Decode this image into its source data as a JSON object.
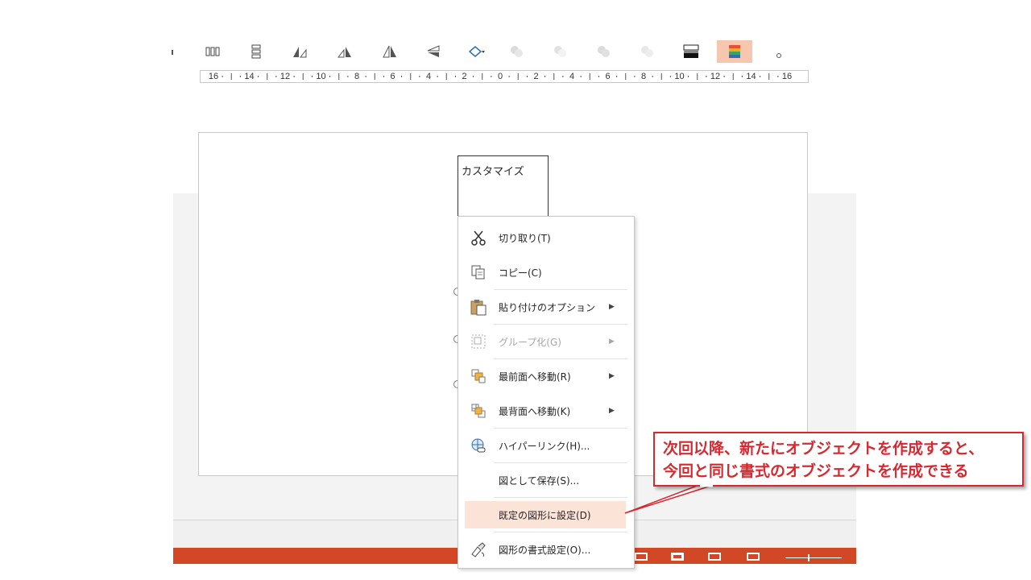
{
  "toolbar": {
    "buttons": [
      {
        "name": "distribute-horizontally-icon"
      },
      {
        "name": "distribute-vertically-icon"
      },
      {
        "name": "rotate-left-icon"
      },
      {
        "name": "rotate-right-icon"
      },
      {
        "name": "flip-horizontal-icon"
      },
      {
        "name": "flip-vertical-icon"
      },
      {
        "name": "edit-shape-icon"
      },
      {
        "name": "shape-effect-1-icon"
      },
      {
        "name": "shape-effect-2-icon"
      },
      {
        "name": "shape-effect-3-icon"
      },
      {
        "name": "shape-effect-4-icon"
      },
      {
        "name": "gradient-fill-icon"
      },
      {
        "name": "color-fill-icon",
        "active": true
      }
    ]
  },
  "ruler": {
    "labels": [
      "16",
      "14",
      "12",
      "10",
      "8",
      "6",
      "4",
      "2",
      "0",
      "2",
      "4",
      "6",
      "8",
      "10",
      "12",
      "14",
      "16"
    ]
  },
  "slide": {
    "shape_text": "カスタマイズ"
  },
  "context_menu": {
    "items": [
      {
        "label": "切り取り(T)",
        "icon": "scissors-icon",
        "submenu": false,
        "enabled": true
      },
      {
        "label": "コピー(C)",
        "icon": "copy-icon",
        "submenu": false,
        "enabled": true
      },
      {
        "label": "貼り付けのオプション",
        "icon": "paste-icon",
        "submenu": true,
        "enabled": true
      },
      {
        "label": "グループ化(G)",
        "icon": "group-icon",
        "submenu": true,
        "enabled": false
      },
      {
        "label": "最前面へ移動(R)",
        "icon": "bring-to-front-icon",
        "submenu": true,
        "enabled": true
      },
      {
        "label": "最背面へ移動(K)",
        "icon": "send-to-back-icon",
        "submenu": true,
        "enabled": true
      },
      {
        "label": "ハイパーリンク(H)...",
        "icon": "hyperlink-icon",
        "submenu": false,
        "enabled": true
      },
      {
        "label": "図として保存(S)...",
        "icon": "",
        "submenu": false,
        "enabled": true
      },
      {
        "label": "既定の図形に設定(D)",
        "icon": "",
        "submenu": false,
        "enabled": true,
        "highlighted": true
      },
      {
        "label": "図形の書式設定(O)...",
        "icon": "format-shape-icon",
        "submenu": false,
        "enabled": true
      }
    ]
  },
  "callout": {
    "line1": "次回以降、新たにオブジェクトを作成すると、",
    "line2": "今回と同じ書式のオブジェクトを作成できる",
    "color": "#d7282f"
  },
  "colors": {
    "accent": "#d24726",
    "highlight": "#fbe3d8",
    "active_button": "#f7c6ae"
  }
}
